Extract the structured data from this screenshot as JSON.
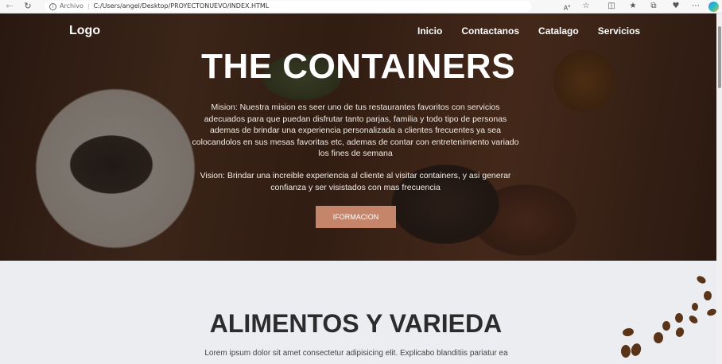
{
  "browser": {
    "archivo": "Archivo",
    "url": "C:/Users/angel/Desktop/PROYECTONUEVO/INDEX.HTML"
  },
  "header": {
    "logo": "Logo",
    "nav": [
      "Inicio",
      "Contactanos",
      "Catalago",
      "Servicios"
    ]
  },
  "hero": {
    "title": "THE CONTAINERS",
    "mision": "Mision: Nuestra mision es seer uno de tus restaurantes favoritos con servicios adecuados para que puedan disfrutar tanto parjas, familia y todo tipo de personas ademas de brindar una experiencia personalizada a clientes frecuentes ya sea colocandolos en sus mesas favoritas etc, ademas de contar con entretenimiento variado los fines de semana",
    "vision": "Vision: Brindar una increible experiencia al cliente al visitar containers, y asi generar confianza y ser visistados con mas frecuencia",
    "button": "IFORMACION"
  },
  "section": {
    "title": "ALIMENTOS Y VARIEDA",
    "text": "Lorem ipsum dolor sit amet consectetur adipisicing elit. Explicabo blanditiis pariatur ea"
  },
  "colors": {
    "button": "#c5856b",
    "section_bg": "#ecedf1"
  }
}
